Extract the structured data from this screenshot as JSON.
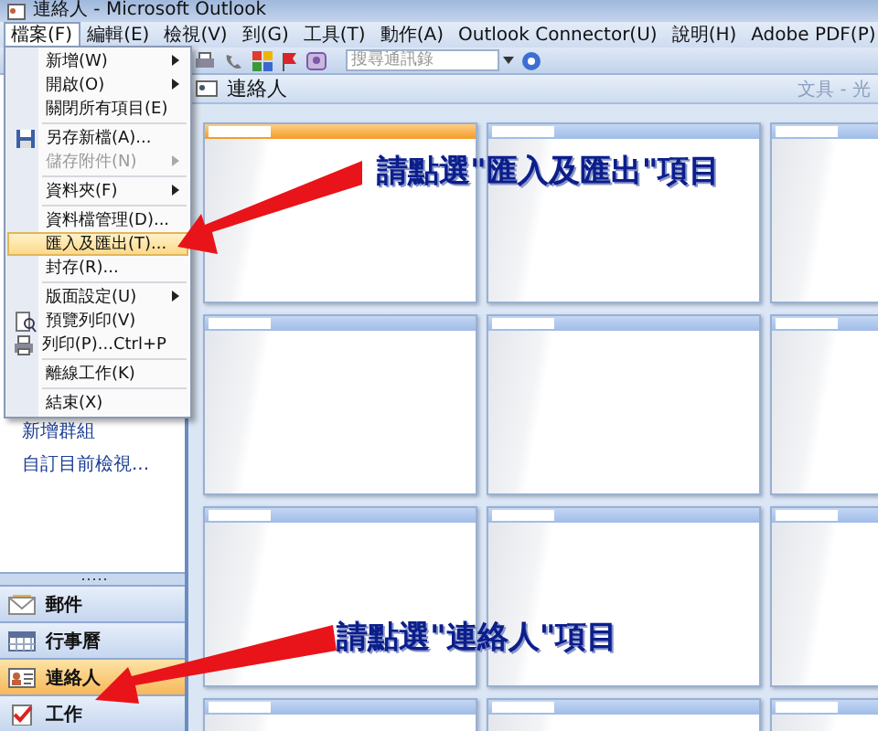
{
  "window": {
    "title": "連絡人 - Microsoft Outlook"
  },
  "menu_bar": [
    {
      "label": "檔案(F)",
      "selected": true
    },
    {
      "label": "編輯(E)",
      "selected": false
    },
    {
      "label": "檢視(V)",
      "selected": false
    },
    {
      "label": "到(G)",
      "selected": false
    },
    {
      "label": "工具(T)",
      "selected": false
    },
    {
      "label": "動作(A)",
      "selected": false
    },
    {
      "label": "Outlook Connector(U)",
      "selected": false
    },
    {
      "label": "說明(H)",
      "selected": false
    },
    {
      "label": "Adobe PDF(P)",
      "selected": false
    }
  ],
  "toolbar": {
    "search": {
      "placeholder": "搜尋通訊錄"
    }
  },
  "file_menu": [
    {
      "label": "新增(W)",
      "submenu": true,
      "disabled": false,
      "selected": false
    },
    {
      "label": "開啟(O)",
      "submenu": true,
      "disabled": false,
      "selected": false
    },
    {
      "label": "關閉所有項目(E)",
      "submenu": false,
      "disabled": false,
      "selected": false
    },
    {
      "label": "另存新檔(A)...",
      "submenu": false,
      "disabled": false,
      "selected": false,
      "separator_before": true
    },
    {
      "label": "儲存附件(N)",
      "submenu": true,
      "disabled": true,
      "selected": false
    },
    {
      "label": "資料夾(F)",
      "submenu": true,
      "disabled": false,
      "selected": false,
      "separator_before": true
    },
    {
      "label": "資料檔管理(D)...",
      "submenu": false,
      "disabled": false,
      "selected": false,
      "separator_before": true
    },
    {
      "label": "匯入及匯出(T)...",
      "submenu": false,
      "disabled": false,
      "selected": true
    },
    {
      "label": "封存(R)...",
      "submenu": false,
      "disabled": false,
      "selected": false
    },
    {
      "label": "版面設定(U)",
      "submenu": true,
      "disabled": false,
      "selected": false,
      "separator_before": true
    },
    {
      "label": "預覽列印(V)",
      "submenu": false,
      "disabled": false,
      "selected": false
    },
    {
      "label": "列印(P)...",
      "shortcut": "Ctrl+P",
      "submenu": false,
      "disabled": false,
      "selected": false
    },
    {
      "label": "離線工作(K)",
      "submenu": false,
      "disabled": false,
      "selected": false,
      "separator_before": true
    },
    {
      "label": "結束(X)",
      "submenu": false,
      "disabled": false,
      "selected": false,
      "separator_before": true
    }
  ],
  "nav_pane": {
    "links": [
      "新增群組",
      "自訂目前檢視..."
    ],
    "buttons": [
      {
        "label": "郵件",
        "selected": false
      },
      {
        "label": "行事曆",
        "selected": false
      },
      {
        "label": "連絡人",
        "selected": true
      },
      {
        "label": "工作",
        "selected": false
      }
    ]
  },
  "content": {
    "title": "連絡人",
    "filter": "文具 - 光",
    "cards": [
      {
        "selected": true
      },
      {
        "selected": false
      },
      {
        "selected": false
      },
      {
        "selected": false
      },
      {
        "selected": false
      },
      {
        "selected": false
      },
      {
        "selected": false
      },
      {
        "selected": false
      },
      {
        "selected": false
      },
      {
        "selected": false
      },
      {
        "selected": false
      },
      {
        "selected": false
      }
    ]
  },
  "annotations": [
    "請點選\"匯入及匯出\"項目",
    "請點選\"連絡人\"項目"
  ]
}
